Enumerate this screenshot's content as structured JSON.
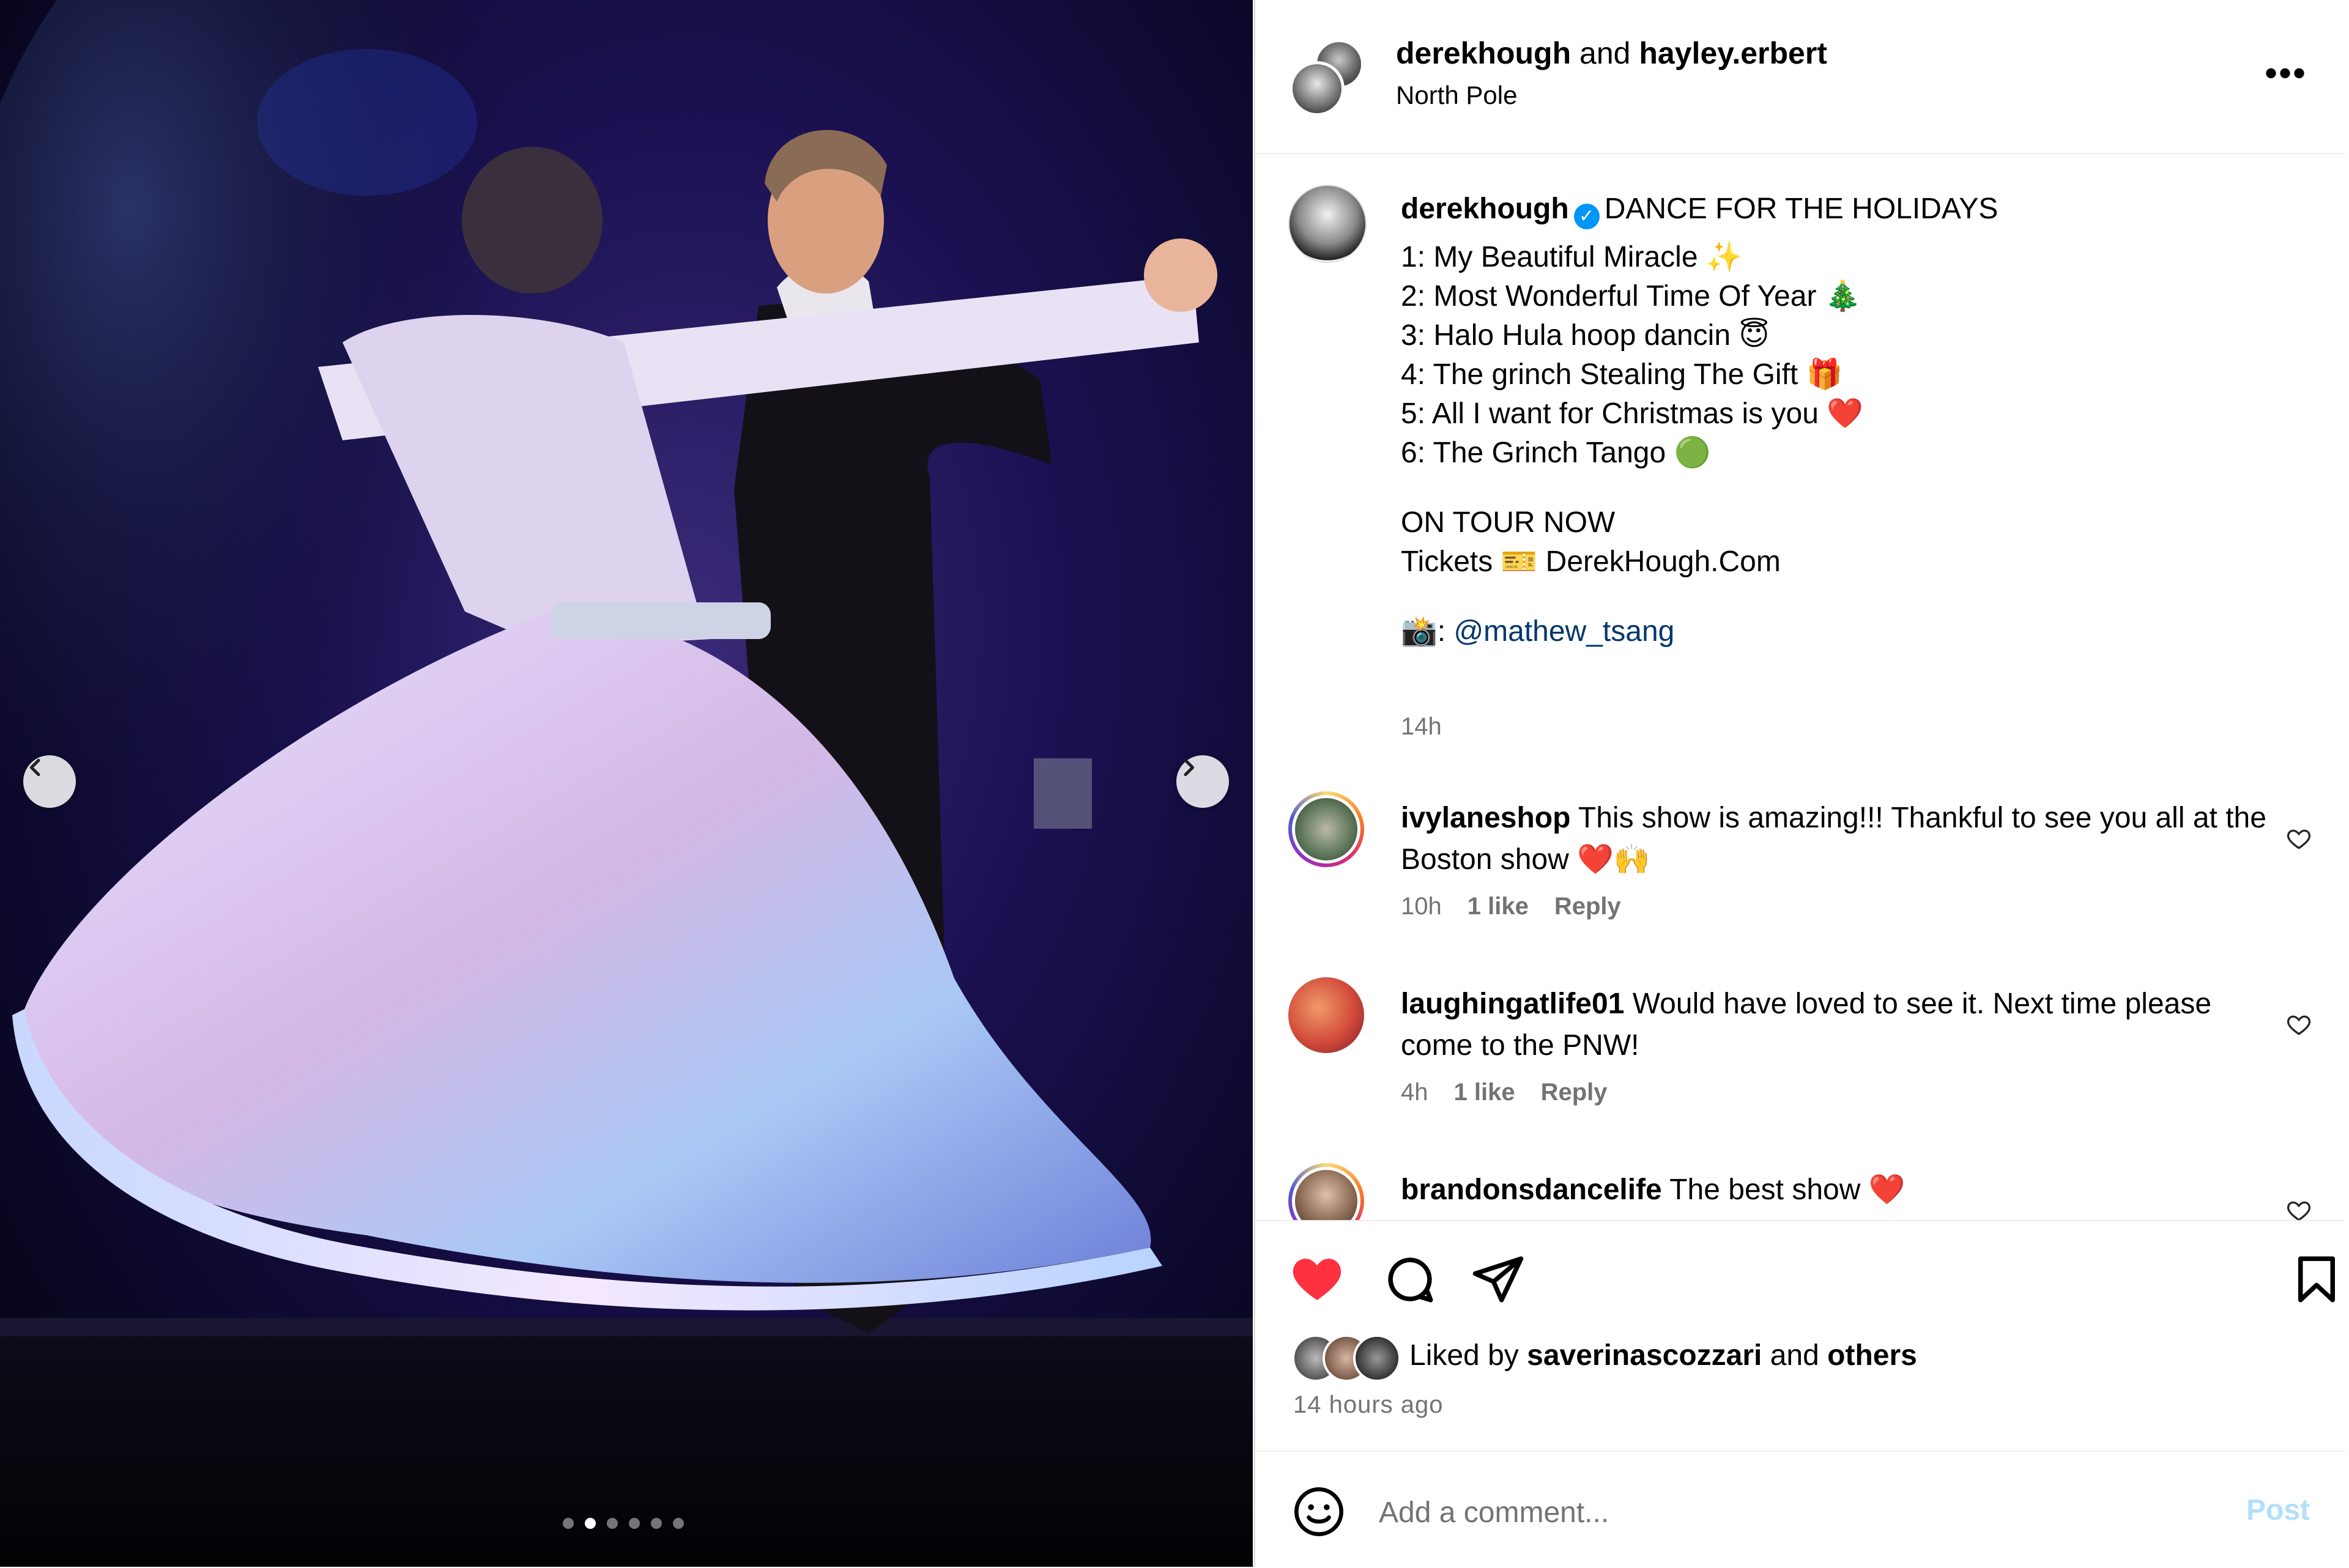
{
  "post": {
    "header": {
      "author": "derekhough",
      "joiner": "and",
      "coauthor": "hayley.erbert",
      "location": "North Pole",
      "more_icon": "more-options-icon"
    },
    "media": {
      "description_icon": "photo",
      "carousel": {
        "count": 6,
        "active": 1
      }
    },
    "caption": {
      "username": "derekhough",
      "verified": true,
      "title": "DANCE FOR THE HOLIDAYS",
      "list": [
        "1: My Beautiful Miracle ✨",
        "2: Most Wonderful Time Of Year 🎄",
        "3: Halo Hula hoop dancin 😇",
        "4: The grinch Stealing The Gift 🎁",
        "5: All I want for Christmas is you ❤️",
        "6: The Grinch Tango 🟢"
      ],
      "tour": "ON TOUR NOW",
      "tickets": "Tickets 🎫 DerekHough.Com",
      "photo_credit_prefix": "📸: ",
      "photo_credit_mention": "@mathew_tsang",
      "time": "14h"
    },
    "comments": [
      {
        "username": "ivylaneshop",
        "text": "This show is amazing!!! Thankful to see you all at the Boston show ❤️🙌",
        "time": "10h",
        "likes": "1 like",
        "reply": "Reply"
      },
      {
        "username": "laughingatlife01",
        "text": "Would have loved to see it. Next time please come to the PNW!",
        "time": "4h",
        "likes": "1 like",
        "reply": "Reply"
      },
      {
        "username": "brandonsdancelife",
        "text": "The best show ❤️"
      }
    ],
    "actions": {
      "liked": true,
      "liked_by_prefix": "Liked by",
      "liked_by_user": "saverinascozzari",
      "liked_by_joiner": "and",
      "liked_by_others": "others",
      "time_ago": "14 hours ago"
    },
    "add_comment": {
      "placeholder": "Add a comment...",
      "post_label": "Post"
    },
    "colors": {
      "like_red": "#ff3040",
      "link_blue": "#00376b",
      "verified_blue": "#0095f6",
      "post_disabled": "#b2dffc",
      "secondary_text": "#737373"
    }
  }
}
